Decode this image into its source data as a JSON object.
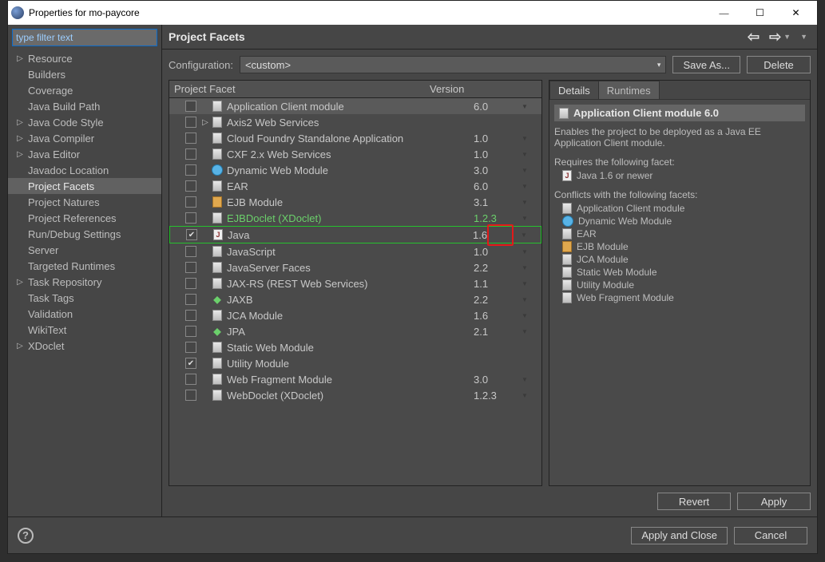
{
  "window": {
    "title": "Properties for mo-paycore"
  },
  "filter_placeholder": "type filter text",
  "sidebar": {
    "items": [
      {
        "label": "Resource",
        "twisty": "▷"
      },
      {
        "label": "Builders",
        "twisty": ""
      },
      {
        "label": "Coverage",
        "twisty": ""
      },
      {
        "label": "Java Build Path",
        "twisty": ""
      },
      {
        "label": "Java Code Style",
        "twisty": "▷"
      },
      {
        "label": "Java Compiler",
        "twisty": "▷"
      },
      {
        "label": "Java Editor",
        "twisty": "▷"
      },
      {
        "label": "Javadoc Location",
        "twisty": ""
      },
      {
        "label": "Project Facets",
        "twisty": "",
        "selected": true
      },
      {
        "label": "Project Natures",
        "twisty": ""
      },
      {
        "label": "Project References",
        "twisty": ""
      },
      {
        "label": "Run/Debug Settings",
        "twisty": ""
      },
      {
        "label": "Server",
        "twisty": ""
      },
      {
        "label": "Targeted Runtimes",
        "twisty": ""
      },
      {
        "label": "Task Repository",
        "twisty": "▷"
      },
      {
        "label": "Task Tags",
        "twisty": ""
      },
      {
        "label": "Validation",
        "twisty": ""
      },
      {
        "label": "WikiText",
        "twisty": ""
      },
      {
        "label": "XDoclet",
        "twisty": "▷"
      }
    ]
  },
  "header_title": "Project Facets",
  "config_label": "Configuration:",
  "config_value": "<custom>",
  "save_as": "Save As...",
  "delete": "Delete",
  "table": {
    "col1": "Project Facet",
    "col2": "Version",
    "rows": [
      {
        "checked": false,
        "twisty": "",
        "icon": "file",
        "name": "Application Client module",
        "ver": "6.0",
        "dd": true,
        "hi": true
      },
      {
        "checked": false,
        "twisty": "▷",
        "icon": "file",
        "name": "Axis2 Web Services",
        "ver": "",
        "dd": false
      },
      {
        "checked": false,
        "twisty": "",
        "icon": "file",
        "name": "Cloud Foundry Standalone Application",
        "ver": "1.0",
        "dd": true
      },
      {
        "checked": false,
        "twisty": "",
        "icon": "file",
        "name": "CXF 2.x Web Services",
        "ver": "1.0",
        "dd": true
      },
      {
        "checked": false,
        "twisty": "",
        "icon": "globe",
        "name": "Dynamic Web Module",
        "ver": "3.0",
        "dd": true
      },
      {
        "checked": false,
        "twisty": "",
        "icon": "file",
        "name": "EAR",
        "ver": "6.0",
        "dd": true
      },
      {
        "checked": false,
        "twisty": "",
        "icon": "jar",
        "name": "EJB Module",
        "ver": "3.1",
        "dd": true
      },
      {
        "checked": false,
        "twisty": "",
        "icon": "file",
        "name": "EJBDoclet (XDoclet)",
        "ver": "1.2.3",
        "dd": true,
        "green": true
      },
      {
        "checked": true,
        "twisty": "",
        "icon": "java",
        "name": "Java",
        "ver": "1.6",
        "dd": true,
        "sel": true,
        "red": true
      },
      {
        "checked": false,
        "twisty": "",
        "icon": "file",
        "name": "JavaScript",
        "ver": "1.0",
        "dd": true
      },
      {
        "checked": false,
        "twisty": "",
        "icon": "file",
        "name": "JavaServer Faces",
        "ver": "2.2",
        "dd": true
      },
      {
        "checked": false,
        "twisty": "",
        "icon": "file",
        "name": "JAX-RS (REST Web Services)",
        "ver": "1.1",
        "dd": true
      },
      {
        "checked": false,
        "twisty": "",
        "icon": "jaxb",
        "name": "JAXB",
        "ver": "2.2",
        "dd": true
      },
      {
        "checked": false,
        "twisty": "",
        "icon": "file",
        "name": "JCA Module",
        "ver": "1.6",
        "dd": true
      },
      {
        "checked": false,
        "twisty": "",
        "icon": "jaxb",
        "name": "JPA",
        "ver": "2.1",
        "dd": true
      },
      {
        "checked": false,
        "twisty": "",
        "icon": "file",
        "name": "Static Web Module",
        "ver": "",
        "dd": false
      },
      {
        "checked": true,
        "twisty": "",
        "icon": "file",
        "name": "Utility Module",
        "ver": "",
        "dd": false
      },
      {
        "checked": false,
        "twisty": "",
        "icon": "file",
        "name": "Web Fragment Module",
        "ver": "3.0",
        "dd": true
      },
      {
        "checked": false,
        "twisty": "",
        "icon": "file",
        "name": "WebDoclet (XDoclet)",
        "ver": "1.2.3",
        "dd": true
      }
    ]
  },
  "tabs": {
    "details": "Details",
    "runtimes": "Runtimes"
  },
  "detail": {
    "title": "Application Client module 6.0",
    "desc1": "Enables the project to be deployed as a Java EE Application Client module.",
    "req_head": "Requires the following facet:",
    "req1": "Java 1.6 or newer",
    "conf_head": "Conflicts with the following facets:",
    "conflicts": [
      {
        "icon": "file",
        "label": "Application Client module"
      },
      {
        "icon": "globe",
        "label": "Dynamic Web Module"
      },
      {
        "icon": "file",
        "label": "EAR"
      },
      {
        "icon": "jar",
        "label": "EJB Module"
      },
      {
        "icon": "file",
        "label": "JCA Module"
      },
      {
        "icon": "file",
        "label": "Static Web Module"
      },
      {
        "icon": "file",
        "label": "Utility Module"
      },
      {
        "icon": "file",
        "label": "Web Fragment Module"
      }
    ]
  },
  "buttons": {
    "revert": "Revert",
    "apply": "Apply",
    "apply_close": "Apply and Close",
    "cancel": "Cancel"
  }
}
